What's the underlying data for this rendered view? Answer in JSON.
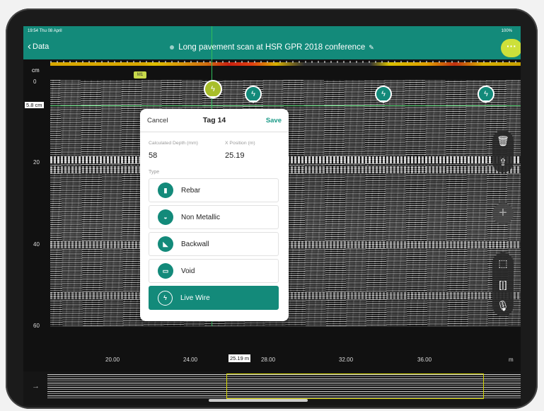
{
  "status": {
    "time": "19:54 Thu 08 April",
    "battery": "100%"
  },
  "nav": {
    "back_label": "Data",
    "title": "Long pavement scan at HSR GPR 2018 conference"
  },
  "axis": {
    "y_unit": "cm",
    "y_ticks": [
      "0",
      "20",
      "40",
      "60"
    ],
    "depth_label": "5.8 cm",
    "x_ticks": [
      "20.00",
      "24.00",
      "28.00",
      "32.00",
      "36.00"
    ],
    "x_unit": "m",
    "x_cursor": "25.19 m"
  },
  "marker_label": "M1",
  "modal": {
    "cancel": "Cancel",
    "title": "Tag 14",
    "save": "Save",
    "depth_label": "Calculated Depth (mm)",
    "depth_value": "58",
    "xpos_label": "X Position (m)",
    "xpos_value": "25.19",
    "type_label": "Type",
    "types": [
      {
        "label": "Rebar",
        "icon": "rebar-icon",
        "glyph": "▮"
      },
      {
        "label": "Non Metallic",
        "icon": "non-metallic-icon",
        "glyph": "◒"
      },
      {
        "label": "Backwall",
        "icon": "backwall-icon",
        "glyph": "◣"
      },
      {
        "label": "Void",
        "icon": "void-icon",
        "glyph": "▭"
      },
      {
        "label": "Live Wire",
        "icon": "lightning-icon",
        "glyph": "ϟ",
        "selected": true
      }
    ]
  },
  "tag_glyph": "ϟ",
  "colors": {
    "accent": "#138a7a",
    "highlight": "#a8be2a"
  }
}
